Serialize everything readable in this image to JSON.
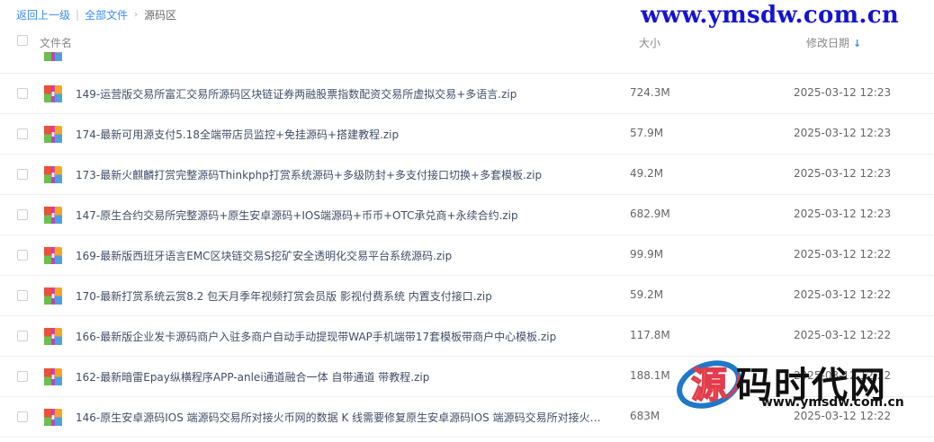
{
  "breadcrumb": {
    "back": "返回上一级",
    "all_files": "全部文件",
    "current": "源码区"
  },
  "watermark_url": "www.ymsdw.com.cn",
  "columns": {
    "name": "文件名",
    "size": "大小",
    "date": "修改日期",
    "sort_icon": "arrow-down-icon"
  },
  "files": [
    {
      "name": "149-运营版交易所富汇交易所源码区块链证券两融股票指数配资交易所虚拟交易+多语言.zip",
      "size": "724.3M",
      "date": "2025-03-12 12:23"
    },
    {
      "name": "174-最新可用源支付5.18全端带店员监控+免挂源码+搭建教程.zip",
      "size": "57.9M",
      "date": "2025-03-12 12:23"
    },
    {
      "name": "173-最新火麒麟打赏完整源码Thinkphp打赏系统源码+多级防封+多支付接口切换+多套模板.zip",
      "size": "49.2M",
      "date": "2025-03-12 12:23"
    },
    {
      "name": "147-原生合约交易所完整源码+原生安卓源码+IOS端源码+币币+OTC承兑商+永续合约.zip",
      "size": "682.9M",
      "date": "2025-03-12 12:23"
    },
    {
      "name": "169-最新版西班牙语言EMC区块链交易S挖矿安全透明化交易平台系统源码.zip",
      "size": "99.9M",
      "date": "2025-03-12 12:22"
    },
    {
      "name": "170-最新打赏系统云赏8.2 包天月季年视频打赏会员版 影视付费系统 内置支付接口.zip",
      "size": "59.2M",
      "date": "2025-03-12 12:22"
    },
    {
      "name": "166-最新版企业发卡源码商户入驻多商户自动手动提现带WAP手机端带17套模板带商户中心模板.zip",
      "size": "117.8M",
      "date": "2025-03-12 12:22"
    },
    {
      "name": "162-最新暗雷Epay纵横程序APP-anlei通道融合一体 自带通道 带教程.zip",
      "size": "188.1M",
      "date": "2025-03-12 12:22"
    },
    {
      "name": "146-原生安卓源码IOS 端源码交易所对接火币网的数据 K 线需要修复原生安卓源码IOS 端源码交易所对接火币...",
      "size": "683M",
      "date": "2025-03-12 12:22"
    }
  ],
  "file_icon": "zip-archive-icon",
  "logo": {
    "brand": "码时代网",
    "url": "www.ymsdw.com.cn",
    "mark_icon": "yuan-character-logo-icon"
  }
}
